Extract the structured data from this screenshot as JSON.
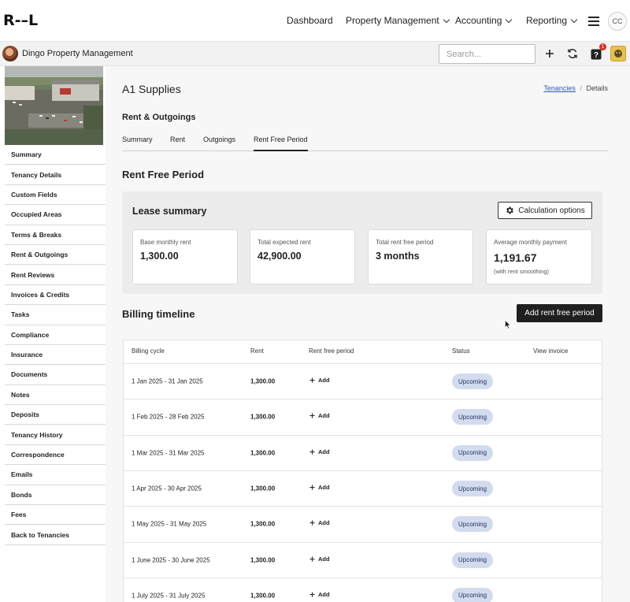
{
  "app": {
    "logo_text": "R-–L"
  },
  "topnav": {
    "items": [
      {
        "label": "Dashboard",
        "has_menu": false
      },
      {
        "label": "Property Management",
        "has_menu": true
      },
      {
        "label": "Accounting",
        "has_menu": true
      },
      {
        "label": "Reporting",
        "has_menu": true
      }
    ],
    "user_initials": "CC"
  },
  "subbar": {
    "org_name": "Dingo Property Management",
    "search_placeholder": "Search...",
    "notification_count": "1",
    "icons": [
      "plus-icon",
      "refresh-icon",
      "help-icon",
      "user-avatar"
    ]
  },
  "sidebar": {
    "items": [
      "Summary",
      "Tenancy Details",
      "Custom Fields",
      "Occupied Areas",
      "Terms & Breaks",
      "Rent & Outgoings",
      "Rent Reviews",
      "Invoices & Credits",
      "Tasks",
      "Compliance",
      "Insurance",
      "Documents",
      "Notes",
      "Deposits",
      "Tenancy History",
      "Correspondence",
      "Emails",
      "Bonds",
      "Fees",
      "Back to Tenancies"
    ]
  },
  "page": {
    "title": "A1 Supplies",
    "breadcrumb": {
      "link": "Tenancies",
      "separator": "/",
      "current": "Details"
    },
    "section_title": "Rent & Outgoings",
    "tabs": [
      {
        "label": "Summary",
        "active": false
      },
      {
        "label": "Rent",
        "active": false
      },
      {
        "label": "Outgoings",
        "active": false
      },
      {
        "label": "Rent Free Period",
        "active": true
      }
    ],
    "heading": "Rent Free Period"
  },
  "lease_summary": {
    "title": "Lease summary",
    "calc_button": "Calculation options",
    "cards": [
      {
        "label": "Base monthly rent",
        "value": "1,300.00"
      },
      {
        "label": "Total expected rent",
        "value": "42,900.00"
      },
      {
        "label": "Total rent free period",
        "value": "3 months"
      },
      {
        "label": "Average monthly payment",
        "value": "1,191.67",
        "note": "(with rent smoothing)"
      }
    ]
  },
  "billing": {
    "title": "Billing timeline",
    "add_button": "Add rent free period",
    "columns": [
      "Billing cycle",
      "Rent",
      "Rent free period",
      "Status",
      "View invoice"
    ],
    "add_label": "Add",
    "rows": [
      {
        "cycle": "1 Jan 2025 - 31 Jan 2025",
        "rent": "1,300.00",
        "status": "Upcoming"
      },
      {
        "cycle": "1 Feb 2025 - 28 Feb 2025",
        "rent": "1,300.00",
        "status": "Upcoming"
      },
      {
        "cycle": "1 Mar 2025 - 31 Mar 2025",
        "rent": "1,300.00",
        "status": "Upcoming"
      },
      {
        "cycle": "1 Apr 2025 - 30 Apr 2025",
        "rent": "1,300.00",
        "status": "Upcoming"
      },
      {
        "cycle": "1 May 2025 - 31 May 2025",
        "rent": "1,300.00",
        "status": "Upcoming"
      },
      {
        "cycle": "1 June 2025 - 30 June 2025",
        "rent": "1,300.00",
        "status": "Upcoming"
      },
      {
        "cycle": "1 July 2025 - 31 July 2025",
        "rent": "1,300.00",
        "status": "Upcoming"
      }
    ]
  },
  "colors": {
    "accent_dark": "#1f1f1f",
    "badge_bg": "#d3dbef",
    "badge_text": "#24335e",
    "link": "#2b5db5"
  }
}
